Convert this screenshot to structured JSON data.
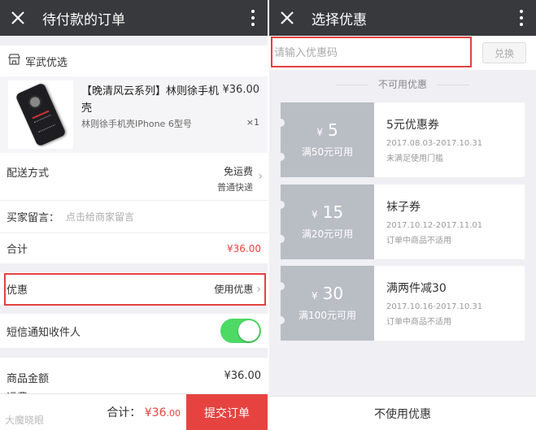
{
  "left": {
    "title": "待付款的订单",
    "shop_name": "军武优选",
    "product": {
      "name": "【晚清风云系列】林则徐手机壳",
      "spec": "林则徐手机壳IPhone 6型号",
      "price": "¥36.00",
      "qty": "×1"
    },
    "shipping": {
      "label": "配送方式",
      "fee": "免运费",
      "method": "普通快递"
    },
    "message": {
      "label": "买家留言：",
      "placeholder": "点击给商家留言"
    },
    "subtotal": {
      "label": "合计",
      "amount": "¥36.00"
    },
    "coupon": {
      "label": "优惠",
      "value": "使用优惠"
    },
    "sms": {
      "label": "短信通知收件人",
      "enabled": true
    },
    "goods_amount": {
      "label": "商品金额",
      "amount": "¥36.00"
    },
    "shipping_fee_label": "运费",
    "footer": {
      "total_label": "合计：",
      "total_amount": "¥36",
      "total_cents": ".00",
      "submit_label": "提交订单"
    },
    "watermark": "大魔晓眼"
  },
  "right": {
    "title": "选择优惠",
    "code_placeholder": "请输入优惠码",
    "redeem_label": "兑换",
    "section_label": "不可用优惠",
    "coupons": [
      {
        "currency": "¥",
        "amount": "5",
        "condition": "满50元可用",
        "name": "5元优惠券",
        "date": "2017.08.03-2017.10.31",
        "note": "未满足使用门槛"
      },
      {
        "currency": "¥",
        "amount": "15",
        "condition": "满20元可用",
        "name": "袜子券",
        "date": "2017.10.12-2017.11.01",
        "note": "订单中商品不适用"
      },
      {
        "currency": "¥",
        "amount": "30",
        "condition": "满100元可用",
        "name": "满两件减30",
        "date": "2017.10.16-2017.10.31",
        "note": "订单中商品不适用"
      }
    ],
    "no_coupon_label": "不使用优惠"
  },
  "colors": {
    "topbar": "#38393d",
    "accent_red": "#e64340",
    "toggle_on": "#4cd964",
    "coupon_stub": "#b9bdc4"
  }
}
